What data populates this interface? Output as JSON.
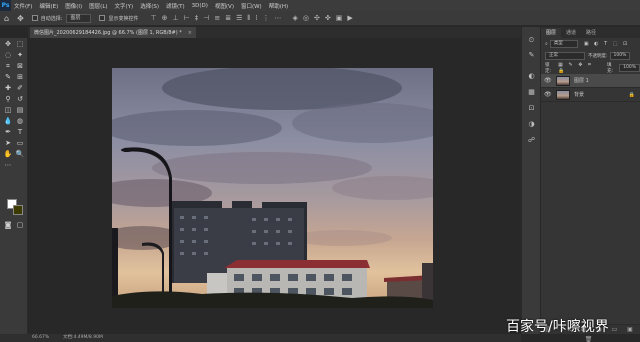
{
  "app": {
    "logo": "Ps"
  },
  "menus": [
    "文件(F)",
    "编辑(E)",
    "图像(I)",
    "图层(L)",
    "文字(Y)",
    "选择(S)",
    "滤镜(T)",
    "3D(D)",
    "视图(V)",
    "窗口(W)",
    "帮助(H)"
  ],
  "options": {
    "auto_select_label": "自动选择:",
    "auto_select_value": "图层",
    "show_transform_label": "显示变换控件"
  },
  "document": {
    "tab_title": "微信图片_20200629184426.jpg @ 66.7% (图层 1, RGB/8#) *",
    "close_glyph": "×"
  },
  "status": {
    "zoom": "66.67%",
    "doc_info": "文档:4.49M/8.90M"
  },
  "layers_panel": {
    "tabs": [
      "图层",
      "通道",
      "路径"
    ],
    "filter_kind": "类型",
    "blend_mode": "正常",
    "opacity_label": "不透明度:",
    "opacity_value": "100%",
    "lock_label": "锁定:",
    "fill_label": "填充:",
    "fill_value": "100%",
    "layers": [
      {
        "name": "图层 1",
        "visible": true,
        "selected": true
      },
      {
        "name": "背景",
        "visible": true,
        "selected": false,
        "locked": true
      }
    ],
    "footer_icons": "⛓ fx ◐ ◑ ▭ ▣ 🗑"
  },
  "watermark": "百家号/咔嚓视界",
  "colors": {
    "foreground": "#ffffff",
    "background": "#3b3b00",
    "panel": "#353535",
    "canvas_bg": "#282828"
  }
}
